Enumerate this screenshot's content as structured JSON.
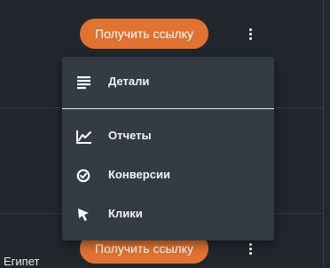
{
  "rows": [
    {
      "button_label": "Получить ссылку"
    },
    {
      "button_label": "Получить ссылку",
      "country": "Египет"
    }
  ],
  "menu": {
    "items": [
      {
        "label": "Детали",
        "icon": "details-icon"
      },
      {
        "label": "Отчеты",
        "icon": "chart-icon"
      },
      {
        "label": "Конверсии",
        "icon": "check-circle-icon"
      },
      {
        "label": "Клики",
        "icon": "cursor-icon"
      }
    ]
  },
  "colors": {
    "accent": "#e07232",
    "background": "#22272d",
    "menu_background": "#333c45"
  }
}
